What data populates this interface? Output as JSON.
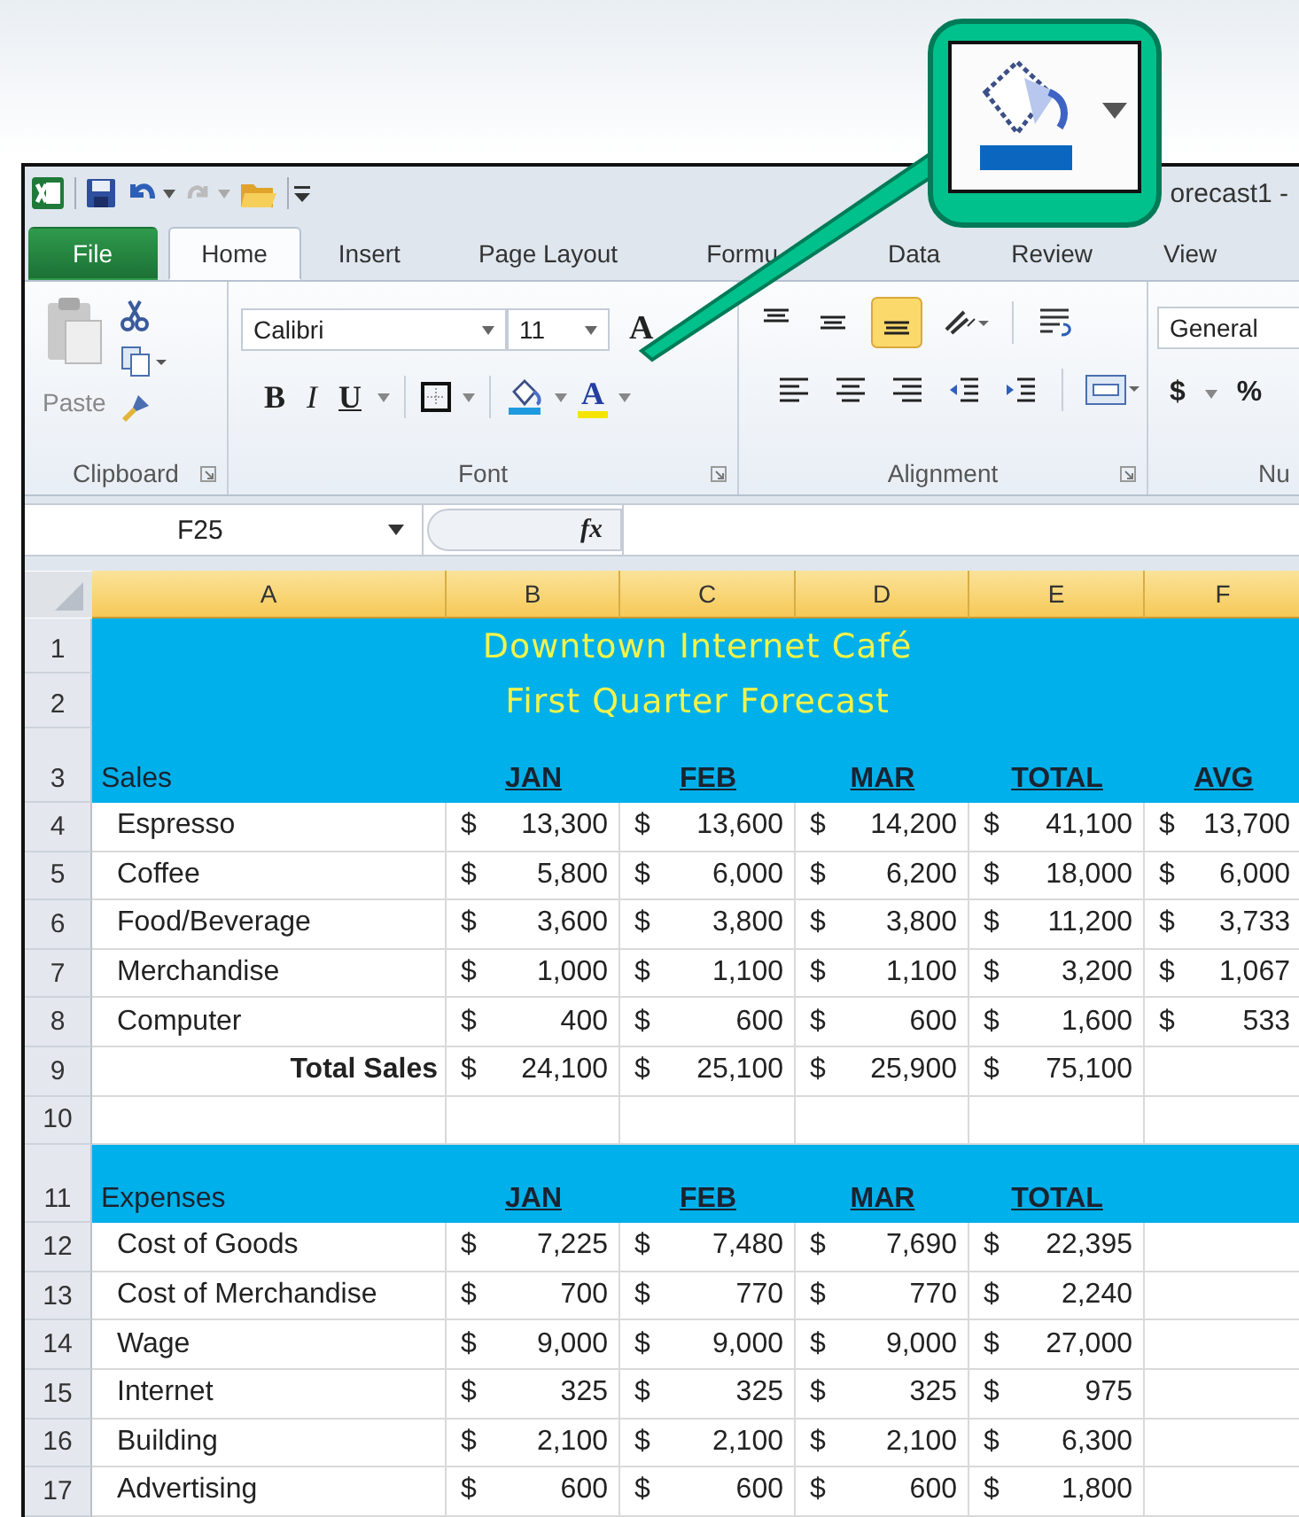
{
  "window": {
    "title": "orecast1 -"
  },
  "tabs": [
    {
      "label": "File",
      "kind": "file",
      "selected": false
    },
    {
      "label": "Home",
      "kind": "tab",
      "selected": true
    },
    {
      "label": "Insert",
      "kind": "tab",
      "selected": false
    },
    {
      "label": "Page Layout",
      "kind": "tab",
      "selected": false
    },
    {
      "label": "Formu",
      "kind": "tab",
      "selected": false
    },
    {
      "label": "Data",
      "kind": "tab",
      "selected": false
    },
    {
      "label": "Review",
      "kind": "tab",
      "selected": false
    },
    {
      "label": "View",
      "kind": "tab",
      "selected": false
    }
  ],
  "ribbon": {
    "paste_label": "Paste",
    "font_name": "Calibri",
    "font_size": "11",
    "grow_font": "A",
    "bold": "B",
    "italic": "I",
    "underline": "U",
    "font_color": "A",
    "number_format": "General",
    "currency": "$",
    "percent": "%",
    "groups": [
      "Clipboard",
      "Font",
      "Alignment",
      "Nu"
    ]
  },
  "formula_bar": {
    "name_box": "F25",
    "function_label": "fx"
  },
  "columns": [
    "A",
    "B",
    "C",
    "D",
    "E",
    "F"
  ],
  "rows": [
    {
      "number": "1",
      "kind": "title",
      "label": "Downtown Internet Café"
    },
    {
      "number": "2",
      "kind": "title",
      "label": "First Quarter Forecast"
    },
    {
      "number": "3",
      "kind": "header",
      "label": "Sales",
      "cells": [
        "JAN",
        "FEB",
        "MAR",
        "TOTAL",
        "AVG"
      ]
    },
    {
      "number": "4",
      "kind": "data",
      "label": "Espresso",
      "cells": [
        {
          "sign": "$",
          "amount": "13,300"
        },
        {
          "sign": "$",
          "amount": "13,600"
        },
        {
          "sign": "$",
          "amount": "14,200"
        },
        {
          "sign": "$",
          "amount": "41,100"
        },
        {
          "sign": "$",
          "amount": "13,700"
        }
      ]
    },
    {
      "number": "5",
      "kind": "data",
      "label": "Coffee",
      "cells": [
        {
          "sign": "$",
          "amount": "5,800"
        },
        {
          "sign": "$",
          "amount": "6,000"
        },
        {
          "sign": "$",
          "amount": "6,200"
        },
        {
          "sign": "$",
          "amount": "18,000"
        },
        {
          "sign": "$",
          "amount": "6,000"
        }
      ]
    },
    {
      "number": "6",
      "kind": "data",
      "label": "Food/Beverage",
      "cells": [
        {
          "sign": "$",
          "amount": "3,600"
        },
        {
          "sign": "$",
          "amount": "3,800"
        },
        {
          "sign": "$",
          "amount": "3,800"
        },
        {
          "sign": "$",
          "amount": "11,200"
        },
        {
          "sign": "$",
          "amount": "3,733"
        }
      ]
    },
    {
      "number": "7",
      "kind": "data",
      "label": "Merchandise",
      "cells": [
        {
          "sign": "$",
          "amount": "1,000"
        },
        {
          "sign": "$",
          "amount": "1,100"
        },
        {
          "sign": "$",
          "amount": "1,100"
        },
        {
          "sign": "$",
          "amount": "3,200"
        },
        {
          "sign": "$",
          "amount": "1,067"
        }
      ]
    },
    {
      "number": "8",
      "kind": "data",
      "label": "Computer",
      "cells": [
        {
          "sign": "$",
          "amount": "400"
        },
        {
          "sign": "$",
          "amount": "600"
        },
        {
          "sign": "$",
          "amount": "600"
        },
        {
          "sign": "$",
          "amount": "1,600"
        },
        {
          "sign": "$",
          "amount": "533"
        }
      ]
    },
    {
      "number": "9",
      "kind": "total",
      "label": "Total Sales",
      "cells": [
        {
          "sign": "$",
          "amount": "24,100"
        },
        {
          "sign": "$",
          "amount": "25,100"
        },
        {
          "sign": "$",
          "amount": "25,900"
        },
        {
          "sign": "$",
          "amount": "75,100"
        }
      ]
    },
    {
      "number": "10",
      "kind": "blank"
    },
    {
      "number": "11",
      "kind": "header",
      "label": "Expenses",
      "cells": [
        "JAN",
        "FEB",
        "MAR",
        "TOTAL"
      ]
    },
    {
      "number": "12",
      "kind": "data",
      "label": "Cost of Goods",
      "cells": [
        {
          "sign": "$",
          "amount": "7,225"
        },
        {
          "sign": "$",
          "amount": "7,480"
        },
        {
          "sign": "$",
          "amount": "7,690"
        },
        {
          "sign": "$",
          "amount": "22,395"
        }
      ]
    },
    {
      "number": "13",
      "kind": "data",
      "label": "Cost of Merchandise",
      "cells": [
        {
          "sign": "$",
          "amount": "700"
        },
        {
          "sign": "$",
          "amount": "770"
        },
        {
          "sign": "$",
          "amount": "770"
        },
        {
          "sign": "$",
          "amount": "2,240"
        }
      ]
    },
    {
      "number": "14",
      "kind": "data",
      "label": "Wage",
      "cells": [
        {
          "sign": "$",
          "amount": "9,000"
        },
        {
          "sign": "$",
          "amount": "9,000"
        },
        {
          "sign": "$",
          "amount": "9,000"
        },
        {
          "sign": "$",
          "amount": "27,000"
        }
      ]
    },
    {
      "number": "15",
      "kind": "data",
      "label": "Internet",
      "cells": [
        {
          "sign": "$",
          "amount": "325"
        },
        {
          "sign": "$",
          "amount": "325"
        },
        {
          "sign": "$",
          "amount": "325"
        },
        {
          "sign": "$",
          "amount": "975"
        }
      ]
    },
    {
      "number": "16",
      "kind": "data",
      "label": "Building",
      "cells": [
        {
          "sign": "$",
          "amount": "2,100"
        },
        {
          "sign": "$",
          "amount": "2,100"
        },
        {
          "sign": "$",
          "amount": "2,100"
        },
        {
          "sign": "$",
          "amount": "6,300"
        }
      ]
    },
    {
      "number": "17",
      "kind": "data",
      "label": "Advertising",
      "cells": [
        {
          "sign": "$",
          "amount": "600"
        },
        {
          "sign": "$",
          "amount": "600"
        },
        {
          "sign": "$",
          "amount": "600"
        },
        {
          "sign": "$",
          "amount": "1,800"
        }
      ]
    }
  ]
}
